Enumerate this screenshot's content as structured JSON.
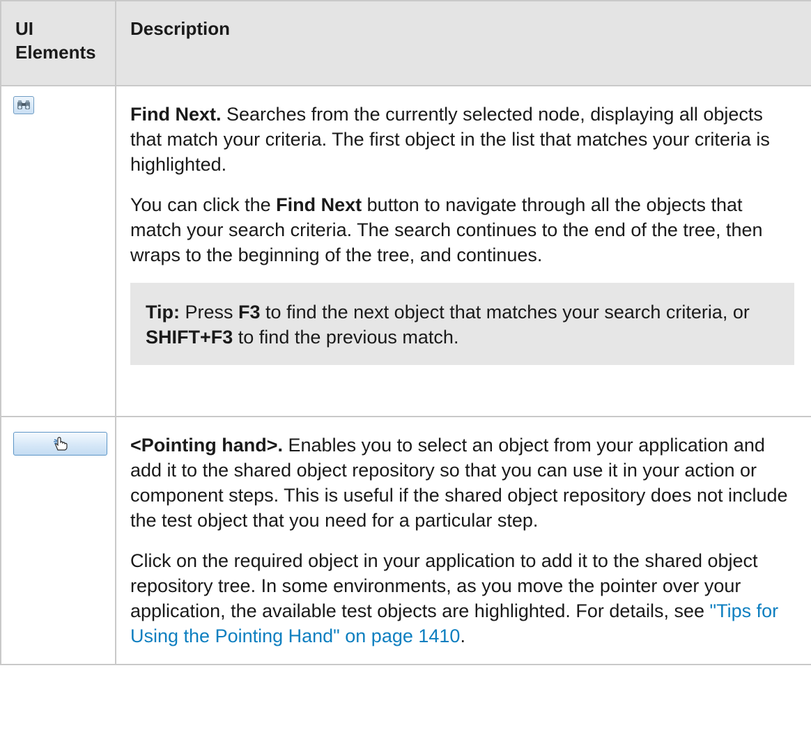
{
  "table": {
    "headers": {
      "col1_line1": "UI",
      "col1_line2": "Elements",
      "col2": "Description"
    },
    "rows": [
      {
        "icon": "binoculars-icon",
        "p1_bold": "Find Next.",
        "p1_text": " Searches from the currently selected node, displaying all objects that match your criteria. The first object in the list that matches your criteria is highlighted.",
        "p2_a": "You can click the ",
        "p2_bold": "Find Next",
        "p2_b": " button to navigate through all the objects that match your search criteria. The search continues to the end of the tree, then wraps to the beginning of the tree, and continues.",
        "tip_label": "Tip:",
        "tip_a": " Press ",
        "tip_key1": "F3",
        "tip_b": " to find the next object that matches your search criteria, or ",
        "tip_key2": "SHIFT+F3",
        "tip_c": " to find the previous match."
      },
      {
        "icon": "pointing-hand-icon",
        "p1_bold": "<Pointing hand>.",
        "p1_text": " Enables you to select an object from your application and add it to the shared object repository so that you can use it in your action or component steps. This is useful if the shared object repository does not include the test object that you need for a particular step.",
        "p2_a": "Click on the required object in your application to add it to the shared object repository tree. In some environments, as you move the pointer over your application, the available test objects are highlighted. For details, see ",
        "p2_link": "\"Tips for Using the Pointing Hand\" on page 1410",
        "p2_b": "."
      }
    ]
  },
  "colors": {
    "header_bg": "#e4e4e4",
    "tip_bg": "#e6e6e6",
    "link": "#0e7fc0",
    "border": "#c9c9c9"
  }
}
